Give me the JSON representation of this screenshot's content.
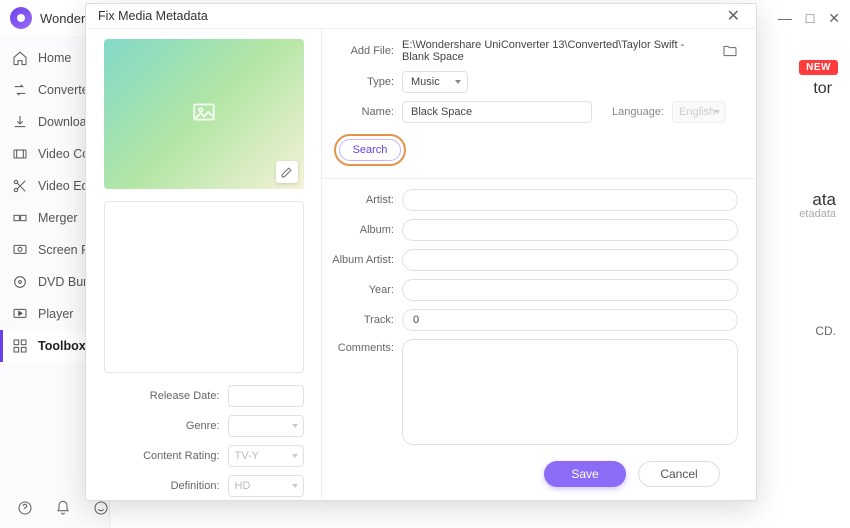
{
  "app": {
    "title": "Wonder"
  },
  "window_controls": {
    "min": "—",
    "max": "□",
    "close": "✕"
  },
  "sidebar": {
    "items": [
      {
        "label": "Home"
      },
      {
        "label": "Converter"
      },
      {
        "label": "Download"
      },
      {
        "label": "Video Co"
      },
      {
        "label": "Video Ed"
      },
      {
        "label": "Merger"
      },
      {
        "label": "Screen R"
      },
      {
        "label": "DVD Bur"
      },
      {
        "label": "Player"
      },
      {
        "label": "Toolbox"
      }
    ]
  },
  "background": {
    "new_badge": "NEW",
    "w1": "tor",
    "w2": "ata",
    "w3": "etadata",
    "w4": "CD."
  },
  "modal": {
    "title": "Fix Media Metadata",
    "add_file_label": "Add File:",
    "add_file_value": "E:\\Wondershare UniConverter 13\\Converted\\Taylor Swift - Blank Space",
    "type_label": "Type:",
    "type_value": "Music",
    "name_label": "Name:",
    "name_value": "Black Space",
    "language_label": "Language:",
    "language_value": "English",
    "search_label": "Search",
    "artist_label": "Artist:",
    "album_label": "Album:",
    "album_artist_label": "Album Artist:",
    "year_label": "Year:",
    "track_label": "Track:",
    "track_value": "0",
    "comments_label": "Comments:",
    "left": {
      "release_label": "Release Date:",
      "genre_label": "Genre:",
      "rating_label": "Content Rating:",
      "rating_value": "TV-Y",
      "definition_label": "Definition:",
      "definition_value": "HD"
    },
    "footer": {
      "save": "Save",
      "cancel": "Cancel"
    }
  }
}
